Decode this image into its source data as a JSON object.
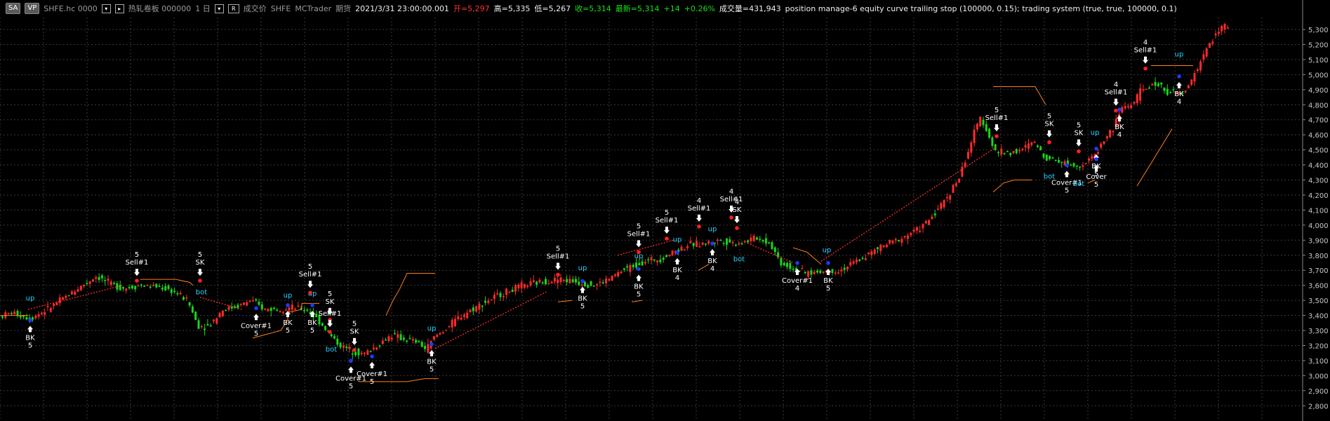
{
  "header": {
    "btn_sa": "SA",
    "btn_vp": "VP",
    "symbol": "SHFE.hc 0000",
    "contract": "热轧卷板 000000",
    "period": "1 日",
    "btn_r": "R",
    "price_type": "成交价",
    "exchange": "SHFE",
    "source": "MCTrader",
    "market": "期货",
    "datetime": "2021/3/31  23:00:00.001",
    "open": "开=5,297",
    "high": "高=5,335",
    "low": "低=5,267",
    "close": "收=5,314",
    "latest": "最新=5,314",
    "change": "+14",
    "change_pct": "+0.26%",
    "volume": "成交量=431,943",
    "strategy": "position manage-6 equity curve trailing stop (100000,  0.15); trading system (true,  true,  100000,  0.1)"
  },
  "colors": {
    "up": "#ff2a2a",
    "down": "#19d619",
    "signal_white": "#ffffff",
    "signal_cyan": "#2ad4ff",
    "stop_line": "#ff7f1a",
    "trail": "#ff2a2a",
    "grid": "#3a3a3a"
  },
  "chart_data": {
    "type": "candlestick",
    "y_ticks": [
      "5,300",
      "5,200",
      "5,100",
      "5,000",
      "4,900",
      "4,800",
      "4,700",
      "4,600",
      "4,500",
      "4,400",
      "4,300",
      "4,200",
      "4,100",
      "4,000",
      "3,900",
      "3,800",
      "3,700",
      "3,600",
      "3,500",
      "3,400",
      "3,300",
      "3,200",
      "3,100",
      "3,000",
      "2,900",
      "2,800"
    ],
    "ylim": [
      2780,
      5380
    ],
    "price_path": [
      [
        0,
        3390
      ],
      [
        20,
        3420
      ],
      [
        45,
        3380
      ],
      [
        70,
        3440
      ],
      [
        95,
        3520
      ],
      [
        120,
        3600
      ],
      [
        140,
        3660
      ],
      [
        160,
        3610
      ],
      [
        180,
        3580
      ],
      [
        200,
        3600
      ],
      [
        230,
        3590
      ],
      [
        250,
        3560
      ],
      [
        270,
        3500
      ],
      [
        285,
        3330
      ],
      [
        300,
        3330
      ],
      [
        320,
        3440
      ],
      [
        340,
        3460
      ],
      [
        360,
        3500
      ],
      [
        380,
        3440
      ],
      [
        400,
        3450
      ],
      [
        420,
        3450
      ],
      [
        440,
        3440
      ],
      [
        460,
        3350
      ],
      [
        475,
        3260
      ],
      [
        490,
        3190
      ],
      [
        505,
        3170
      ],
      [
        520,
        3140
      ],
      [
        540,
        3200
      ],
      [
        560,
        3270
      ],
      [
        580,
        3240
      ],
      [
        600,
        3220
      ],
      [
        610,
        3170
      ],
      [
        620,
        3250
      ],
      [
        640,
        3320
      ],
      [
        660,
        3400
      ],
      [
        690,
        3480
      ],
      [
        720,
        3550
      ],
      [
        750,
        3600
      ],
      [
        780,
        3630
      ],
      [
        800,
        3640
      ],
      [
        830,
        3620
      ],
      [
        850,
        3600
      ],
      [
        870,
        3640
      ],
      [
        890,
        3700
      ],
      [
        920,
        3760
      ],
      [
        945,
        3780
      ],
      [
        965,
        3830
      ],
      [
        985,
        3870
      ],
      [
        1010,
        3880
      ],
      [
        1030,
        3900
      ],
      [
        1050,
        3880
      ],
      [
        1065,
        3890
      ],
      [
        1080,
        3920
      ],
      [
        1100,
        3880
      ],
      [
        1115,
        3750
      ],
      [
        1130,
        3720
      ],
      [
        1150,
        3680
      ],
      [
        1170,
        3690
      ],
      [
        1200,
        3700
      ],
      [
        1230,
        3780
      ],
      [
        1260,
        3860
      ],
      [
        1290,
        3920
      ],
      [
        1320,
        4000
      ],
      [
        1345,
        4140
      ],
      [
        1370,
        4320
      ],
      [
        1390,
        4600
      ],
      [
        1400,
        4720
      ],
      [
        1410,
        4620
      ],
      [
        1420,
        4490
      ],
      [
        1440,
        4480
      ],
      [
        1460,
        4500
      ],
      [
        1475,
        4560
      ],
      [
        1490,
        4460
      ],
      [
        1510,
        4430
      ],
      [
        1530,
        4400
      ],
      [
        1545,
        4400
      ],
      [
        1560,
        4450
      ],
      [
        1575,
        4560
      ],
      [
        1590,
        4650
      ],
      [
        1600,
        4780
      ],
      [
        1615,
        4800
      ],
      [
        1630,
        4900
      ],
      [
        1650,
        4940
      ],
      [
        1670,
        4880
      ],
      [
        1690,
        4870
      ],
      [
        1705,
        5010
      ],
      [
        1720,
        5150
      ],
      [
        1735,
        5280
      ],
      [
        1748,
        5320
      ]
    ],
    "trail_segments": [
      [
        [
          40,
          3440
        ],
        [
          175,
          3600
        ]
      ],
      [
        [
          285,
          3520
        ],
        [
          345,
          3440
        ]
      ],
      [
        [
          620,
          3180
        ],
        [
          780,
          3560
        ]
      ],
      [
        [
          880,
          3800
        ],
        [
          960,
          3900
        ]
      ],
      [
        [
          1065,
          3880
        ],
        [
          1130,
          3750
        ]
      ],
      [
        [
          1170,
          3760
        ],
        [
          1420,
          4520
        ]
      ]
    ],
    "stop_segments": [
      [
        [
          0,
          3400
        ],
        [
          40,
          3400
        ]
      ],
      [
        [
          200,
          3640
        ],
        [
          250,
          3640
        ],
        [
          270,
          3620
        ],
        [
          275,
          3600
        ]
      ],
      [
        [
          360,
          3250
        ],
        [
          400,
          3300
        ],
        [
          410,
          3370
        ],
        [
          410,
          3420
        ],
        [
          430,
          3440
        ],
        [
          430,
          3480
        ],
        [
          455,
          3480
        ]
      ],
      [
        [
          510,
          2960
        ],
        [
          580,
          2960
        ],
        [
          605,
          2980
        ],
        [
          625,
          2980
        ]
      ],
      [
        [
          550,
          3400
        ],
        [
          560,
          3500
        ],
        [
          570,
          3580
        ],
        [
          580,
          3680
        ],
        [
          620,
          3680
        ]
      ],
      [
        [
          795,
          3490
        ],
        [
          815,
          3500
        ]
      ],
      [
        [
          900,
          3490
        ],
        [
          915,
          3500
        ]
      ],
      [
        [
          995,
          3700
        ],
        [
          1010,
          3740
        ]
      ],
      [
        [
          1130,
          3850
        ],
        [
          1150,
          3820
        ],
        [
          1170,
          3740
        ]
      ],
      [
        [
          1415,
          4220
        ],
        [
          1430,
          4280
        ],
        [
          1445,
          4300
        ],
        [
          1470,
          4300
        ]
      ],
      [
        [
          1415,
          4920
        ],
        [
          1475,
          4920
        ],
        [
          1490,
          4800
        ]
      ],
      [
        [
          1550,
          4280
        ],
        [
          1560,
          4300
        ]
      ],
      [
        [
          1620,
          4260
        ],
        [
          1640,
          4410
        ],
        [
          1670,
          4640
        ]
      ],
      [
        [
          1640,
          5060
        ],
        [
          1700,
          5060
        ]
      ]
    ],
    "signals": [
      {
        "x": 43,
        "price": 3340,
        "text": "BK",
        "qty": "5",
        "color": "white",
        "side": "below"
      },
      {
        "x": 43,
        "price": 3500,
        "text": "up",
        "color": "cyan",
        "side": "text"
      },
      {
        "x": 195,
        "price": 3640,
        "text": "Sell#1",
        "qty": "5",
        "color": "white",
        "side": "above"
      },
      {
        "x": 285,
        "price": 3640,
        "text": "SK",
        "qty": "5",
        "color": "white",
        "side": "above"
      },
      {
        "x": 287,
        "price": 3540,
        "text": "bot",
        "color": "cyan",
        "side": "text"
      },
      {
        "x": 365,
        "price": 3420,
        "text": "Cover#1",
        "qty": "5",
        "color": "white",
        "side": "below"
      },
      {
        "x": 410,
        "price": 3520,
        "text": "up",
        "color": "cyan",
        "side": "text"
      },
      {
        "x": 410,
        "price": 3440,
        "text": "BK",
        "qty": "5",
        "color": "white",
        "side": "below"
      },
      {
        "x": 445,
        "price": 3530,
        "text": "up",
        "color": "cyan",
        "side": "text"
      },
      {
        "x": 445,
        "price": 3440,
        "text": "BK",
        "qty": "5",
        "color": "white",
        "side": "below"
      },
      {
        "x": 442,
        "price": 3560,
        "text": "Sell#1",
        "qty": "5",
        "color": "white",
        "side": "above"
      },
      {
        "x": 470,
        "price": 3380,
        "text": "SK",
        "qty": "5",
        "color": "white",
        "side": "above"
      },
      {
        "x": 470,
        "price": 3300,
        "text": "Sell#1",
        "color": "white",
        "side": "above"
      },
      {
        "x": 472,
        "price": 3160,
        "text": "bot",
        "color": "cyan",
        "side": "text"
      },
      {
        "x": 505,
        "price": 3180,
        "text": "SK",
        "qty": "5",
        "color": "white",
        "side": "above"
      },
      {
        "x": 500,
        "price": 3070,
        "text": "Cover#1",
        "qty": "5",
        "color": "white",
        "side": "below"
      },
      {
        "x": 530,
        "price": 3100,
        "text": "Cover#1",
        "qty": "5",
        "color": "white",
        "side": "below"
      },
      {
        "x": 615,
        "price": 3300,
        "text": "up",
        "color": "cyan",
        "side": "text"
      },
      {
        "x": 615,
        "price": 3180,
        "text": "BK",
        "qty": "5",
        "color": "white",
        "side": "below"
      },
      {
        "x": 795,
        "price": 3680,
        "text": "Sell#1",
        "qty": "5",
        "color": "white",
        "side": "above"
      },
      {
        "x": 830,
        "price": 3700,
        "text": "up",
        "color": "cyan",
        "side": "text"
      },
      {
        "x": 830,
        "price": 3600,
        "text": "BK",
        "qty": "5",
        "color": "white",
        "side": "below"
      },
      {
        "x": 910,
        "price": 3830,
        "text": "Sell#1",
        "qty": "5",
        "color": "white",
        "side": "above"
      },
      {
        "x": 910,
        "price": 3780,
        "text": "up",
        "color": "cyan",
        "side": "text"
      },
      {
        "x": 910,
        "price": 3680,
        "text": "BK",
        "qty": "5",
        "color": "white",
        "side": "below"
      },
      {
        "x": 950,
        "price": 3920,
        "text": "Sell#1",
        "qty": "5",
        "color": "white",
        "side": "above"
      },
      {
        "x": 965,
        "price": 3890,
        "text": "up",
        "color": "cyan",
        "side": "text"
      },
      {
        "x": 965,
        "price": 3790,
        "text": "BK",
        "qty": "4",
        "color": "white",
        "side": "below"
      },
      {
        "x": 996,
        "price": 4000,
        "text": "Sell#1",
        "qty": "4",
        "color": "white",
        "side": "above"
      },
      {
        "x": 1015,
        "price": 3960,
        "text": "up",
        "color": "cyan",
        "side": "text"
      },
      {
        "x": 1015,
        "price": 3850,
        "text": "BK",
        "qty": "4",
        "color": "white",
        "side": "below"
      },
      {
        "x": 1042,
        "price": 4060,
        "text": "Sell#1",
        "qty": "4",
        "color": "white",
        "side": "above"
      },
      {
        "x": 1050,
        "price": 3990,
        "text": "SK",
        "qty": "4",
        "color": "white",
        "side": "above"
      },
      {
        "x": 1053,
        "price": 3760,
        "text": "bot",
        "color": "cyan",
        "side": "text"
      },
      {
        "x": 1136,
        "price": 3720,
        "text": "Cover#1",
        "qty": "4",
        "color": "white",
        "side": "below"
      },
      {
        "x": 1178,
        "price": 3820,
        "text": "up",
        "color": "cyan",
        "side": "text"
      },
      {
        "x": 1180,
        "price": 3720,
        "text": "BK",
        "qty": "5",
        "color": "white",
        "side": "below"
      },
      {
        "x": 1420,
        "price": 4600,
        "text": "Sell#1",
        "qty": "5",
        "color": "white",
        "side": "above"
      },
      {
        "x": 1495,
        "price": 4560,
        "text": "SK",
        "qty": "5",
        "color": "white",
        "side": "above"
      },
      {
        "x": 1495,
        "price": 4310,
        "text": "bot",
        "color": "cyan",
        "side": "text"
      },
      {
        "x": 1520,
        "price": 4370,
        "text": "Cover#1",
        "qty": "5",
        "color": "white",
        "side": "below"
      },
      {
        "x": 1537,
        "price": 4500,
        "text": "SK",
        "qty": "5",
        "color": "white",
        "side": "above"
      },
      {
        "x": 1537,
        "price": 4260,
        "text": "bot",
        "color": "cyan",
        "side": "text"
      },
      {
        "x": 1560,
        "price": 4600,
        "text": "up",
        "color": "cyan",
        "side": "text"
      },
      {
        "x": 1562,
        "price": 4480,
        "text": "BK",
        "qty": "5",
        "color": "white",
        "side": "below"
      },
      {
        "x": 1562,
        "price": 4410,
        "text": "Cover",
        "qty": "5",
        "color": "white",
        "side": "below"
      },
      {
        "x": 1590,
        "price": 4770,
        "text": "Sell#1",
        "qty": "4",
        "color": "white",
        "side": "above"
      },
      {
        "x": 1595,
        "price": 4740,
        "text": "BK",
        "qty": "4",
        "color": "white",
        "side": "below"
      },
      {
        "x": 1632,
        "price": 5050,
        "text": "Sell#1",
        "qty": "4",
        "color": "white",
        "side": "above"
      },
      {
        "x": 1680,
        "price": 5120,
        "text": "up",
        "color": "cyan",
        "side": "text"
      },
      {
        "x": 1680,
        "price": 4960,
        "text": "BK",
        "qty": "4",
        "color": "white",
        "side": "below"
      }
    ]
  }
}
